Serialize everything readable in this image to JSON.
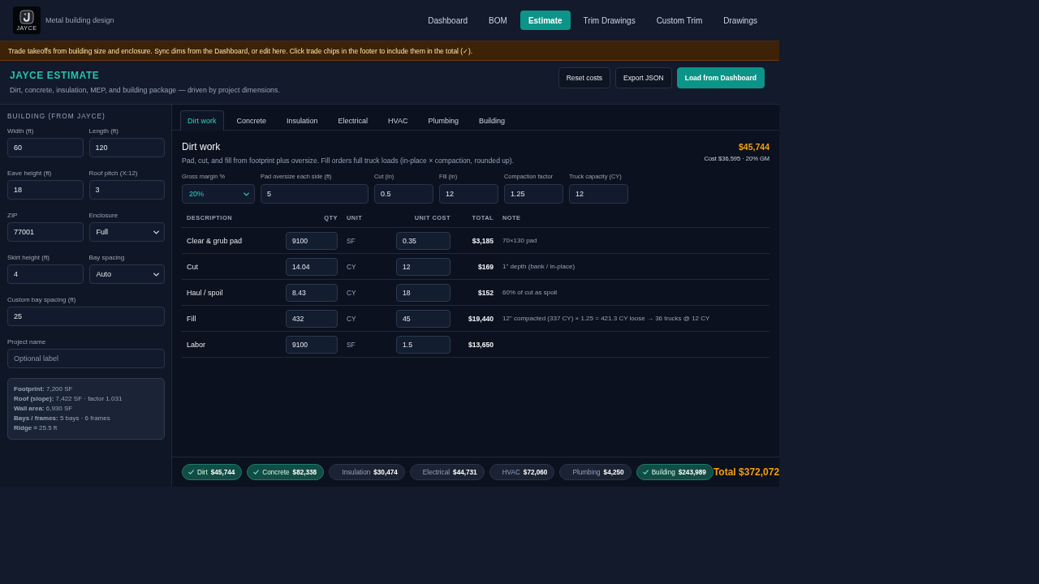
{
  "header": {
    "logo_text": "JAYCE",
    "tagline": "Metal building design"
  },
  "nav": [
    {
      "label": "Dashboard",
      "selected": false
    },
    {
      "label": "BOM",
      "selected": false
    },
    {
      "label": "Estimate",
      "selected": true
    },
    {
      "label": "Trim Drawings",
      "selected": false
    },
    {
      "label": "Custom Trim",
      "selected": false
    },
    {
      "label": "Drawings",
      "selected": false
    }
  ],
  "banner": "Trade takeoffs from building size and enclosure. Sync dims from the Dashboard, or edit here. Click trade chips in the footer to include them in the total (✓).",
  "page_header": {
    "title": "JAYCE ESTIMATE",
    "subtitle": "Dirt, concrete, insulation, MEP, and building package — driven by project dimensions.",
    "buttons": [
      {
        "label": "Reset costs",
        "kind": "secondary"
      },
      {
        "label": "Export JSON",
        "kind": "secondary"
      },
      {
        "label": "Load from Dashboard",
        "kind": "primary"
      }
    ]
  },
  "sidebar": {
    "heading": "BUILDING (FROM JAYCE)",
    "field_rows": [
      [
        {
          "label": "Width (ft)",
          "kind": "input",
          "value": "60"
        },
        {
          "label": "Length (ft)",
          "kind": "input",
          "value": "120"
        }
      ],
      [
        {
          "label": "Eave height (ft)",
          "kind": "input",
          "value": "18"
        },
        {
          "label": "Roof pitch (X:12)",
          "kind": "input",
          "value": "3"
        }
      ],
      [
        {
          "label": "ZIP",
          "kind": "input",
          "value": "77001"
        },
        {
          "label": "Enclosure",
          "kind": "select",
          "value": "Full"
        }
      ],
      [
        {
          "label": "Skirt height (ft)",
          "kind": "input",
          "value": "4"
        },
        {
          "label": "Bay spacing",
          "kind": "select",
          "value": "Auto"
        }
      ],
      [
        {
          "label": "Custom bay spacing (ft)",
          "kind": "input",
          "value": "25"
        }
      ],
      [
        {
          "label": "Project name",
          "kind": "input",
          "placeholder": "Optional label"
        }
      ]
    ],
    "summary": [
      "**Footprint:** 7,200 SF",
      "**Roof (slope):** 7,422 SF · factor 1.031",
      "**Wall area:** 6,930 SF",
      "**Bays / frames:** 5 bays · 6 frames",
      "**Ridge ≈** 25.5 ft"
    ]
  },
  "tabs": [
    {
      "label": "Dirt work",
      "selected": true
    },
    {
      "label": "Concrete",
      "selected": false
    },
    {
      "label": "Insulation",
      "selected": false
    },
    {
      "label": "Electrical",
      "selected": false
    },
    {
      "label": "HVAC",
      "selected": false
    },
    {
      "label": "Plumbing",
      "selected": false
    },
    {
      "label": "Building",
      "selected": false
    }
  ],
  "section": {
    "title": "Dirt work",
    "description": "Pad, cut, and fill from footprint plus oversize. Fill orders full truck loads (in-place × compaction, rounded up).",
    "price": "$45,744",
    "cost_line": "Cost $36,595 · 20% GM",
    "params": [
      {
        "label": "Gross margin %",
        "kind": "select",
        "value": "20%"
      },
      {
        "label": "Pad oversize each side (ft)",
        "kind": "input",
        "value": "5"
      },
      {
        "label": "Cut (in)",
        "kind": "input",
        "value": "0.5"
      },
      {
        "label": "Fill (in)",
        "kind": "input",
        "value": "12"
      },
      {
        "label": "Compaction factor",
        "kind": "input",
        "value": "1.25"
      },
      {
        "label": "Truck capacity (CY)",
        "kind": "input",
        "value": "12"
      }
    ]
  },
  "table": {
    "columns": [
      "DESCRIPTION",
      "QTY",
      "UNIT",
      "UNIT COST",
      "TOTAL",
      "NOTE"
    ],
    "rows": [
      {
        "description": "Clear & grub pad",
        "qty": "9100",
        "unit": "SF",
        "unit_cost": "0.35",
        "total": "$3,185",
        "note": "70×130 pad"
      },
      {
        "description": "Cut",
        "qty": "14.04",
        "unit": "CY",
        "unit_cost": "12",
        "total": "$169",
        "note": "1\" depth (bank / in-place)"
      },
      {
        "description": "Haul / spoil",
        "qty": "8.43",
        "unit": "CY",
        "unit_cost": "18",
        "total": "$152",
        "note": "60% of cut as spoil"
      },
      {
        "description": "Fill",
        "qty": "432",
        "unit": "CY",
        "unit_cost": "45",
        "total": "$19,440",
        "note": "12\" compacted (337 CY) × 1.25 = 421.3 CY loose → 36 trucks @ 12 CY"
      },
      {
        "description": "Labor",
        "qty": "9100",
        "unit": "SF",
        "unit_cost": "1.5",
        "total": "$13,650"
      }
    ]
  },
  "footer": {
    "chips": [
      {
        "label": "Dirt",
        "amount": "$45,744",
        "checked": true
      },
      {
        "label": "Concrete",
        "amount": "$82,338",
        "checked": true
      },
      {
        "label": "Insulation",
        "amount": "$30,474",
        "checked": false
      },
      {
        "label": "Electrical",
        "amount": "$44,731",
        "checked": false
      },
      {
        "label": "HVAC",
        "amount": "$72,060",
        "checked": false
      },
      {
        "label": "Plumbing",
        "amount": "$4,250",
        "checked": false
      },
      {
        "label": "Building",
        "amount": "$243,989",
        "checked": true
      }
    ],
    "total": "Total $372,072"
  }
}
